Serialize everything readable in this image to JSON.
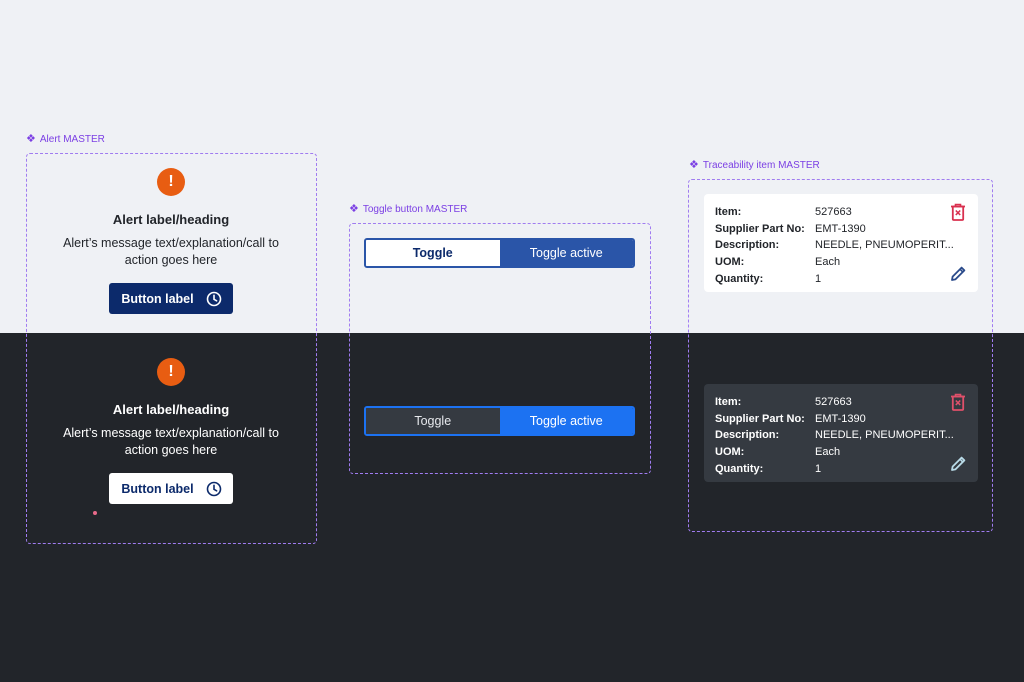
{
  "labels": {
    "alert": "Alert MASTER",
    "toggle": "Toggle button MASTER",
    "trace": "Traceability item MASTER"
  },
  "alert": {
    "icon": "exclamation-icon",
    "heading": "Alert label/heading",
    "message": "Alert’s message text/explanation/call to action goes here",
    "button_label": "Button label",
    "button_icon": "clock-icon"
  },
  "toggle": {
    "off_label": "Toggle",
    "on_label": "Toggle active"
  },
  "trace": {
    "item_label": "Item:",
    "item_value": "527663",
    "supplier_label": "Supplier Part No:",
    "supplier_value": "EMT-1390",
    "description_label": "Description:",
    "description_value": "NEEDLE, PNEUMOPERIT...",
    "uom_label": "UOM:",
    "uom_value": "Each",
    "quantity_label": "Quantity:",
    "quantity_value": "1"
  },
  "colors": {
    "accent_purple": "#7b3fe4",
    "alert_orange": "#e85d12",
    "navy": "#0c2a6b",
    "toggle_blue_light": "#2a55a8",
    "toggle_blue_dark": "#1c72f2",
    "trash_red": "#d9304f",
    "light_bg": "#eff1f5",
    "dark_bg": "#22252a"
  }
}
